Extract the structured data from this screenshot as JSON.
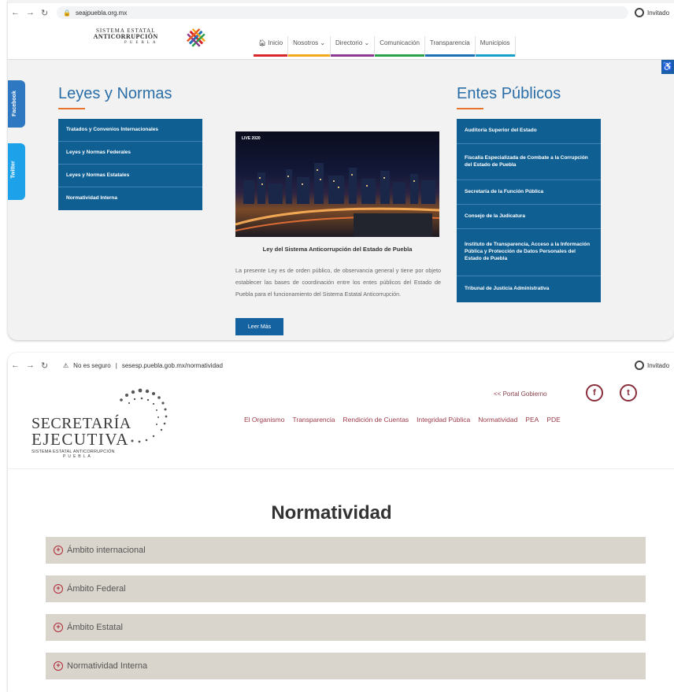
{
  "shot1": {
    "browser": {
      "url": "seajpuebla.org.mx",
      "profile_label": "Invitado"
    },
    "logo": {
      "line1": "SISTEMA ESTATAL",
      "line2": "ANTICORRUPCIÓN",
      "line3": "PUEBLA"
    },
    "nav": [
      {
        "label": "Inicio"
      },
      {
        "label": "Nosotros"
      },
      {
        "label": "Directorio"
      },
      {
        "label": "Comunicación"
      },
      {
        "label": "Transparencia"
      },
      {
        "label": "Municipios"
      }
    ],
    "social": {
      "facebook": "Facebook",
      "twitter": "Twitter"
    },
    "leyes": {
      "title": "Leyes y Normas",
      "items": [
        "Tratados y Convenios Internacionales",
        "Leyes y Normas Federales",
        "Leyes y Normas Estatales",
        "Normatividad Interna"
      ]
    },
    "article": {
      "image_tag": "LIVE 2020",
      "title": "Ley del Sistema Anticorrupción del Estado de Puebla",
      "body": "La presente Ley es de orden público, de observancia general y tiene por objeto establecer las bases de coordinación entre los entes públicos del Estado de Puebla para el funcionamiento del Sistema Estatal Anticorrupción.",
      "button": "Leer Más"
    },
    "entes": {
      "title": "Entes Públicos",
      "items": [
        "Auditoría Superior del Estado",
        "Fiscalía Especializada de Combate a la Corrupción del Estado de Puebla",
        "Secretaría de la Función Pública",
        "Consejo de la Judicatura",
        "Instituto de Transparencia, Acceso a la Información Pública y Protección de Datos Personales del Estado de Puebla",
        "Tribunal de Justicia Administrativa"
      ]
    }
  },
  "shot2": {
    "browser": {
      "security": "No es seguro",
      "url": "sesesp.puebla.gob.mx/normatividad",
      "profile_label": "Invitado"
    },
    "logo": {
      "line1": "SECRETARÍA",
      "line2": "EJECUTIVA",
      "line3": "SISTEMA ESTATAL ANTICORRUPCIÓN",
      "line4": "PUEBLA"
    },
    "portal_link": "<< Portal Gobierno",
    "nav": [
      "El Organismo",
      "Transparencia",
      "Rendición de Cuentas",
      "Integridad Pública",
      "Normatividad",
      "PEA",
      "PDE"
    ],
    "heading": "Normatividad",
    "accordion": [
      "Ámbito internacional",
      "Ámbito Federal",
      "Ámbito Estatal",
      "Normatividad Interna"
    ]
  },
  "colors": {
    "blue_list": "#0f5f93",
    "title_blue": "#2a6ea8",
    "accent_orange": "#e8732a",
    "maroon": "#8a2f3c",
    "accordion_bg": "#d9d4cc"
  }
}
